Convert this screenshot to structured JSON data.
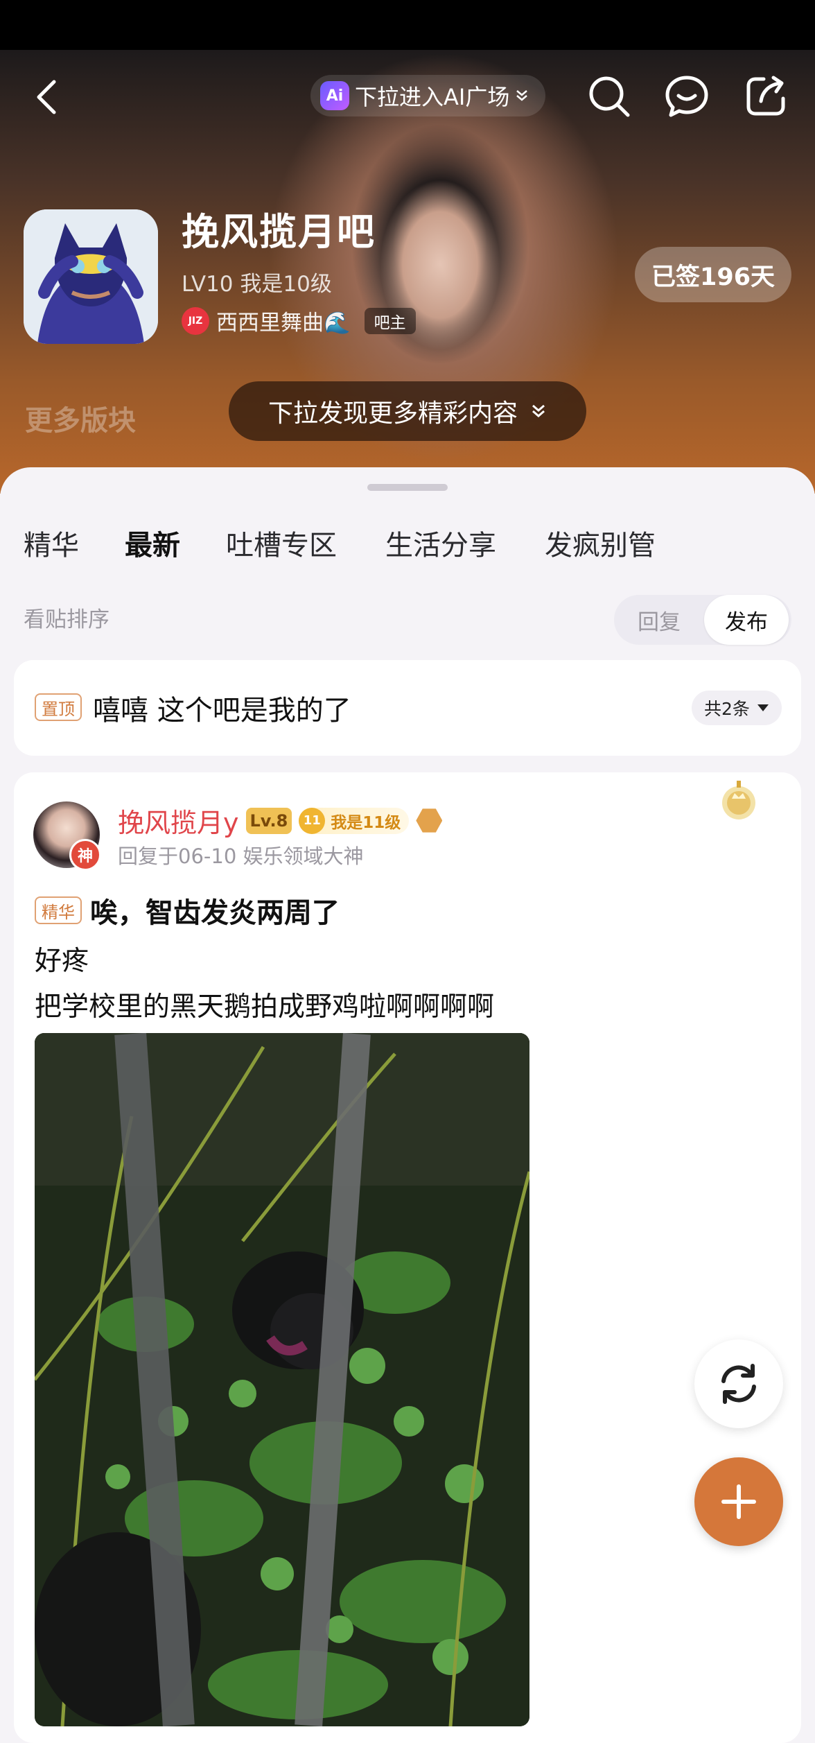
{
  "header": {
    "ai_entry": "下拉进入AI广场",
    "ai_logo": "Ai",
    "forum_name": "挽风揽月吧",
    "forum_level": "LV10 我是10级",
    "owner_name": "西西里舞曲🌊",
    "owner_avatar_text": "JIZ",
    "owner_role": "吧主",
    "signed_days": "已签196天",
    "more_sections": "更多版块",
    "discover_more": "下拉发现更多精彩内容"
  },
  "tabs": [
    "精华",
    "最新",
    "吐槽专区",
    "生活分享",
    "发疯别管"
  ],
  "sort": {
    "label": "看贴排序",
    "options": [
      "回复",
      "发布"
    ],
    "selected": "发布"
  },
  "pinned": {
    "tag": "置顶",
    "text": "嘻嘻 这个吧是我的了",
    "count": "共2条"
  },
  "post": {
    "author": "挽风揽月y",
    "level": "Lv.8",
    "medal_num": "11",
    "medal_text": "我是11级",
    "god_badge": "神",
    "meta": "回复于06-10   娱乐领域大神",
    "essence_tag": "精华",
    "title": "唉，智齿发炎两周了",
    "body_line1": "好疼",
    "body_line2": "把学校里的黑天鹅拍成野鸡啦啊啊啊啊"
  },
  "icons": {
    "back": "back-arrow-icon",
    "search": "search-icon",
    "message": "message-icon",
    "share": "share-icon",
    "refresh": "refresh-icon",
    "add": "plus-icon"
  },
  "colors": {
    "accent": "#d5773a",
    "author": "#e0454a",
    "tag": "#d17b3e"
  }
}
